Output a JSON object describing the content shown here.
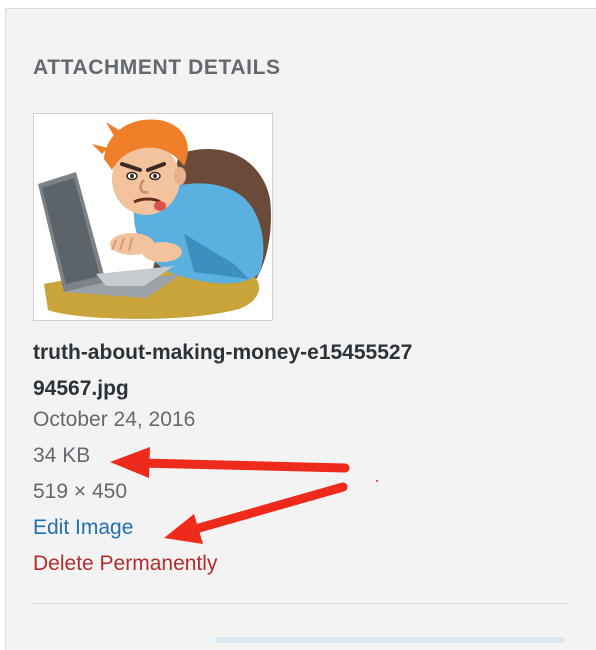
{
  "panel": {
    "heading": "ATTACHMENT DETAILS",
    "thumbnail": {
      "subject": "cartoon man typing on laptop"
    },
    "filename": "truth-about-making-money-e1545552794567.jpg",
    "uploaded_date": "October 24, 2016",
    "file_size": "34 KB",
    "dimensions": "519 × 450",
    "edit_link": "Edit Image",
    "delete_link": "Delete Permanently"
  },
  "colors": {
    "panel_bg": "#f3f3f4",
    "link": "#2271b1",
    "delete": "#b32d2e",
    "annotation_arrow": "#ee2a1a"
  },
  "annotations": [
    {
      "type": "arrow",
      "points_to": "file_size"
    },
    {
      "type": "arrow",
      "points_to": "edit_link"
    }
  ]
}
